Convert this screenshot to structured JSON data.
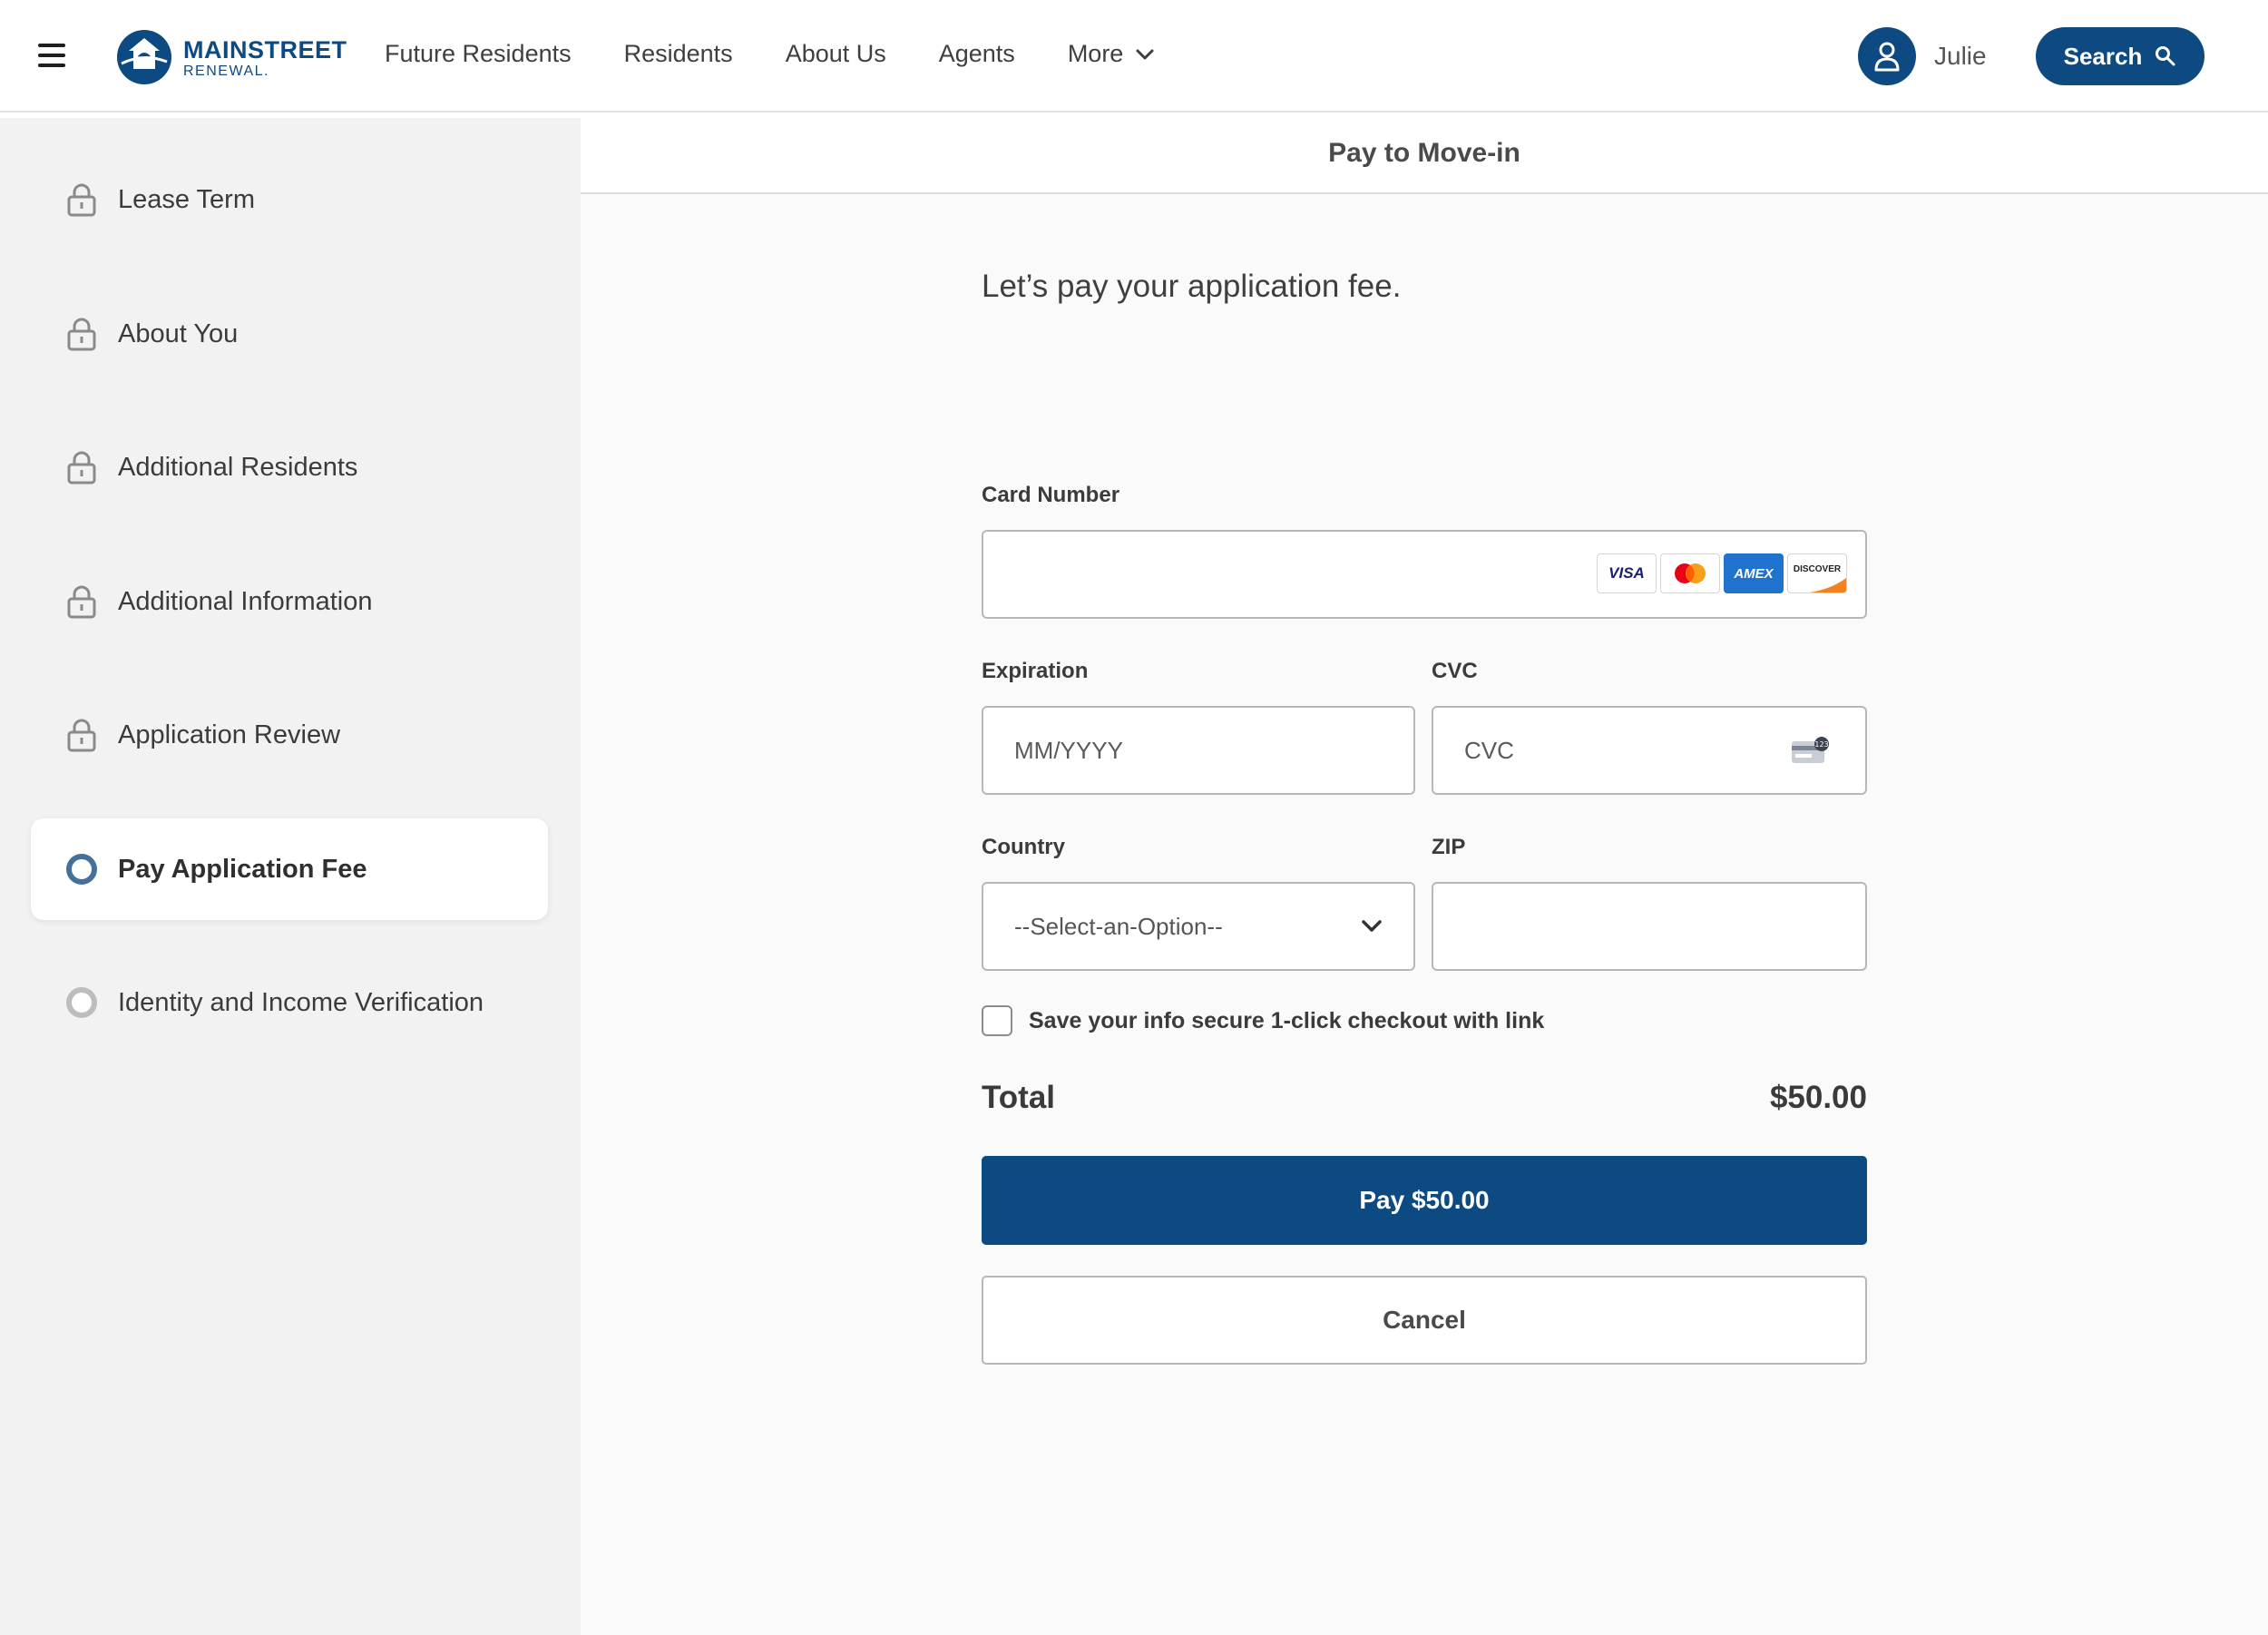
{
  "header": {
    "logo_line1": "MAINSTREET",
    "logo_line2": "RENEWAL.",
    "nav": [
      "Future Residents",
      "Residents",
      "About Us",
      "Agents",
      "More"
    ],
    "user_name": "Julie",
    "search_label": "Search"
  },
  "sidebar": {
    "steps": [
      {
        "label": "Lease Term",
        "state": "locked"
      },
      {
        "label": "About You",
        "state": "locked"
      },
      {
        "label": "Additional Residents",
        "state": "locked"
      },
      {
        "label": "Additional Information",
        "state": "locked"
      },
      {
        "label": "Application Review",
        "state": "locked"
      },
      {
        "label": "Pay Application Fee",
        "state": "active"
      },
      {
        "label": "Identity and Income Verification",
        "state": "pending"
      }
    ]
  },
  "main": {
    "page_title": "Pay to Move-in",
    "heading": "Let’s pay your application fee.",
    "card_number_label": "Card Number",
    "card_number_value": "",
    "card_brands": [
      "VISA",
      "Mastercard",
      "AMEX",
      "DISCOVER"
    ],
    "expiration_label": "Expiration",
    "expiration_placeholder": "MM/YYYY",
    "cvc_label": "CVC",
    "cvc_placeholder": "CVC",
    "country_label": "Country",
    "country_value": "--Select-an-Option--",
    "zip_label": "ZIP",
    "zip_value": "",
    "save_info_label": "Save your info secure 1-click checkout with link",
    "save_info_checked": false,
    "total_label": "Total",
    "total_value": "$50.00",
    "pay_button": "Pay $50.00",
    "cancel_button": "Cancel"
  },
  "colors": {
    "brand": "#0d4a82",
    "active_step": "#44709a",
    "sidebar_bg": "#f2f2f2"
  }
}
